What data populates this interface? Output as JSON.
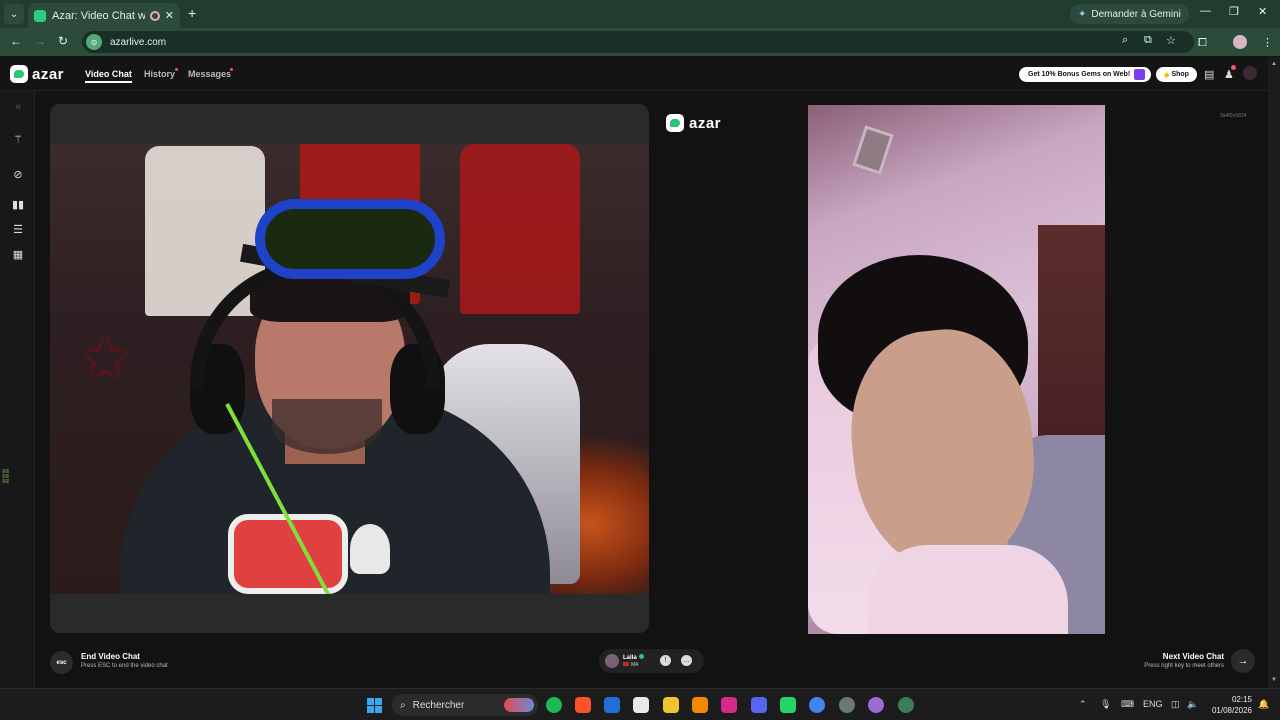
{
  "browser": {
    "tab_title": "Azar: Video Chat with New",
    "new_tab": "+",
    "gemini_label": "Demander à Gemini",
    "url": "azarlive.com"
  },
  "app": {
    "brand": "azar",
    "nav": [
      {
        "label": "Video Chat",
        "active": true
      },
      {
        "label": "History",
        "active": false
      },
      {
        "label": "Messages",
        "active": false
      }
    ],
    "bonus_label": "Get 10% Bonus Gems on Web!",
    "shop_label": "Shop"
  },
  "call": {
    "watermark": "azar",
    "room_code": "3a4f2e5874",
    "esc_label": "esc",
    "end_title": "End Video Chat",
    "end_sub": "Press ESC to end the video chat",
    "peer_name": "Lalla",
    "peer_country": "MA",
    "next_title": "Next Video Chat",
    "next_sub": "Press right key to meet others"
  },
  "taskbar": {
    "search_placeholder": "Rechercher",
    "lang": "ENG",
    "time": "02:15",
    "date": "01/08/2026"
  },
  "colors": {
    "brand_green": "#27c773",
    "chrome_green": "#2c4b3b",
    "badge_red": "#ff4d6d"
  }
}
